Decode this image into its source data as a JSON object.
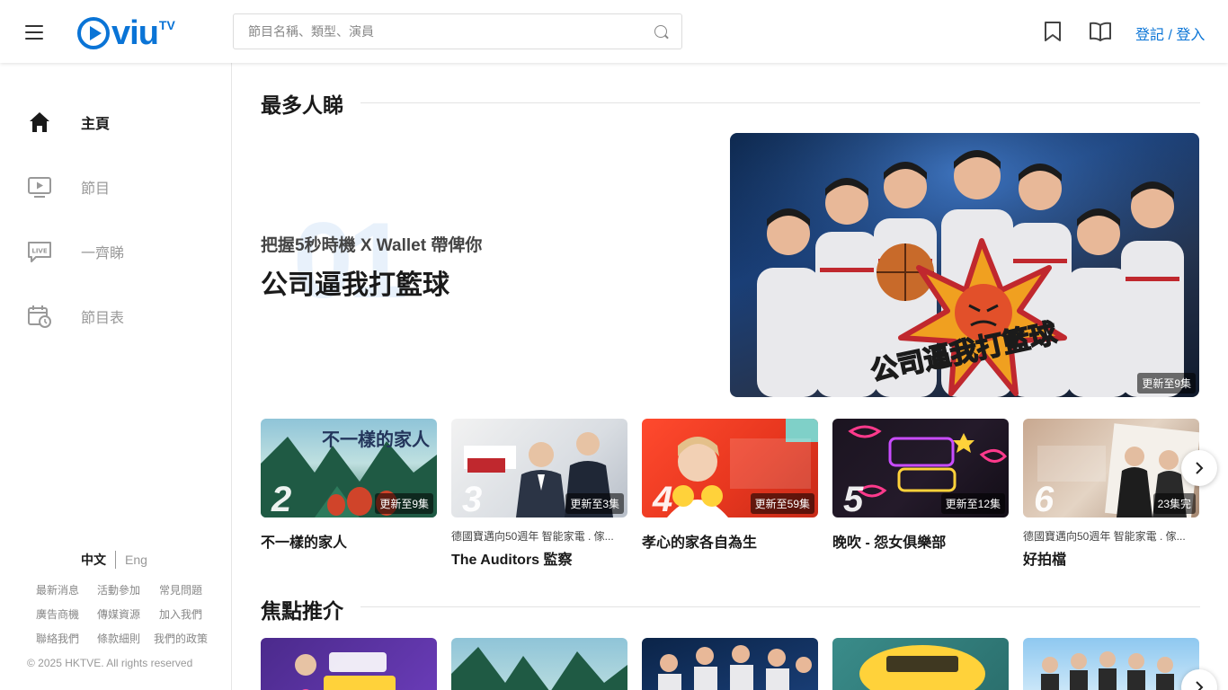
{
  "header": {
    "logo_text": "viu",
    "logo_tv": "TV",
    "search_placeholder": "節目名稱、類型、演員",
    "login_label": "登記 / 登入"
  },
  "sidebar": {
    "items": [
      {
        "label": "主頁",
        "icon": "home-icon",
        "active": true
      },
      {
        "label": "節目",
        "icon": "tv-play-icon"
      },
      {
        "label": "一齊睇",
        "icon": "live-chat-icon"
      },
      {
        "label": "節目表",
        "icon": "calendar-clock-icon"
      }
    ],
    "lang_zh": "中文",
    "lang_en": "Eng",
    "footer_links": [
      "最新消息",
      "活動參加",
      "常見問題",
      "廣告商機",
      "傳媒資源",
      "加入我們",
      "聯絡我們",
      "條款細則",
      "我們的政策"
    ],
    "copyright": "© 2025 HKTVE. All rights reserved"
  },
  "most_watched": {
    "title": "最多人睇",
    "featured": {
      "rank": "01",
      "subtitle": "把握5秒時機 X Wallet 帶俾你",
      "title": "公司逼我打籃球",
      "badge": "更新至9集"
    },
    "cards": [
      {
        "rank": "2",
        "badge": "更新至9集",
        "title": "不一樣的家人",
        "desc": ""
      },
      {
        "rank": "3",
        "badge": "更新至3集",
        "title": "The Auditors 監察",
        "desc": "德國寶邁向50週年 智能家電 . 傢..."
      },
      {
        "rank": "4",
        "badge": "更新至59集",
        "title": "孝心的家各自為生",
        "desc": ""
      },
      {
        "rank": "5",
        "badge": "更新至12集",
        "title": "晚吹 - 怨女俱樂部",
        "desc": ""
      },
      {
        "rank": "6",
        "badge": "23集完",
        "title": "好拍檔",
        "desc": "德國寶邁向50週年 智能家電 . 傢..."
      }
    ]
  },
  "focus": {
    "title": "焦點推介"
  },
  "colors": {
    "accent": "#0a74d6"
  }
}
